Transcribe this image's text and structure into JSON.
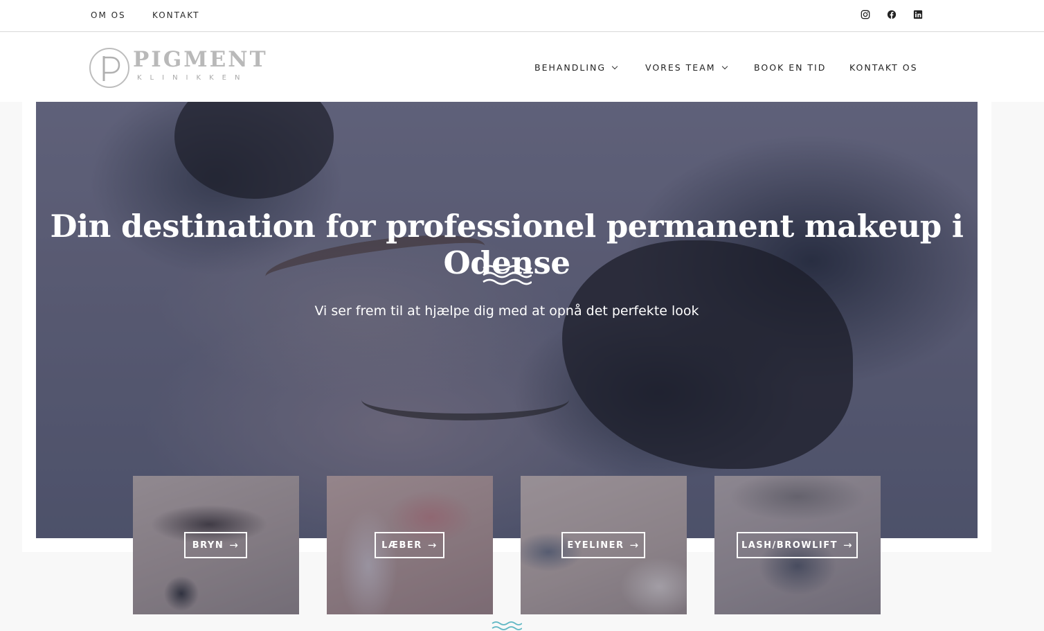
{
  "topbar": {
    "links": [
      "OM OS",
      "KONTAKT"
    ],
    "social": [
      "instagram-icon",
      "facebook-icon",
      "linkedin-icon"
    ]
  },
  "header": {
    "logo_word": "PIGMENT",
    "logo_sub": "KLINIKKEN",
    "nav": [
      {
        "label": "BEHANDLING",
        "dropdown": true
      },
      {
        "label": "VORES TEAM",
        "dropdown": true
      },
      {
        "label": "BOOK EN TID",
        "dropdown": false
      },
      {
        "label": "KONTAKT OS",
        "dropdown": false
      }
    ]
  },
  "hero": {
    "title": "Din destination for professionel permanent makeup i Odense",
    "subtitle": "Vi ser frem til at hjælpe dig med at opnå det perfekte look"
  },
  "cards": [
    {
      "label": "BRYN",
      "arrow": "→"
    },
    {
      "label": "LÆBER",
      "arrow": "→"
    },
    {
      "label": "EYELINER",
      "arrow": "→"
    },
    {
      "label": "LASH/BROWLIFT",
      "arrow": "→"
    }
  ],
  "colors": {
    "accent_waves": "#5fb7c4",
    "text_dark": "#222222",
    "logo_grey": "#b9b9b9"
  }
}
